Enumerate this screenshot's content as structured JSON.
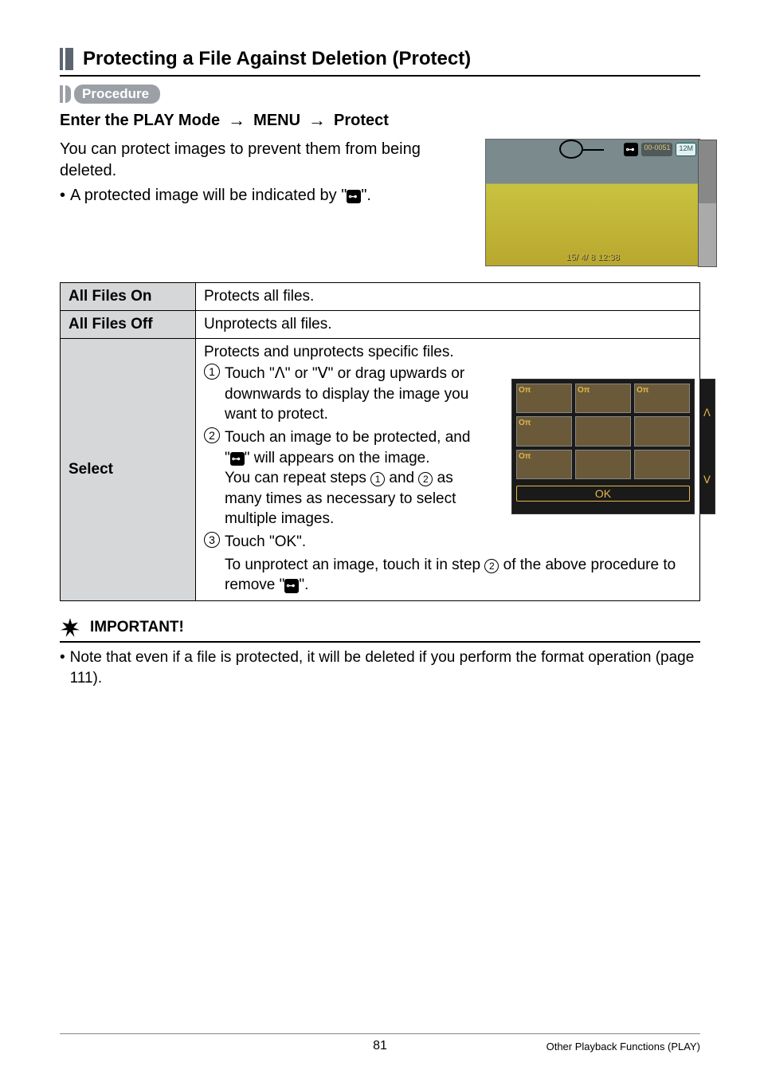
{
  "section": {
    "title": "Protecting a File Against Deletion (Protect)",
    "procedure_label": "Procedure",
    "mode_prefix": "Enter the PLAY Mode",
    "mode_menu": "MENU",
    "mode_protect": "Protect",
    "desc1": "You can protect images to prevent them from being deleted.",
    "desc2_prefix": "A protected image will be indicated by \"",
    "desc2_suffix": "\"."
  },
  "preview": {
    "counter": "00-0051",
    "res": "12M",
    "bottom": "15/ 4/ 8  12:38"
  },
  "table": {
    "row1_label": "All Files On",
    "row1_desc": "Protects all files.",
    "row2_label": "All Files Off",
    "row2_desc": "Unprotects all files.",
    "row3_label": "Select",
    "select_intro": "Protects and unprotects specific files.",
    "step1": "Touch \"ᐱ\" or \"ᐯ\" or drag upwards or downwards to display the image you want to protect.",
    "step2a": "Touch an image to be protected, and \"",
    "step2b": "\" will appears on the image.",
    "step2c": "You can repeat steps",
    "step2d": "and",
    "step2e": "as many times as necessary to select multiple images.",
    "step3": "Touch \"OK\".",
    "unprotect_a": "To unprotect an image, touch it in step",
    "unprotect_b": "of the above procedure to remove \"",
    "unprotect_c": "\"."
  },
  "thumbs": {
    "ok": "OK"
  },
  "important": {
    "label": "IMPORTANT!",
    "note": "Note that even if a file is protected, it will be deleted if you perform the format operation (page 111)."
  },
  "footer": {
    "page": "81",
    "right": "Other Playback Functions (PLAY)"
  }
}
